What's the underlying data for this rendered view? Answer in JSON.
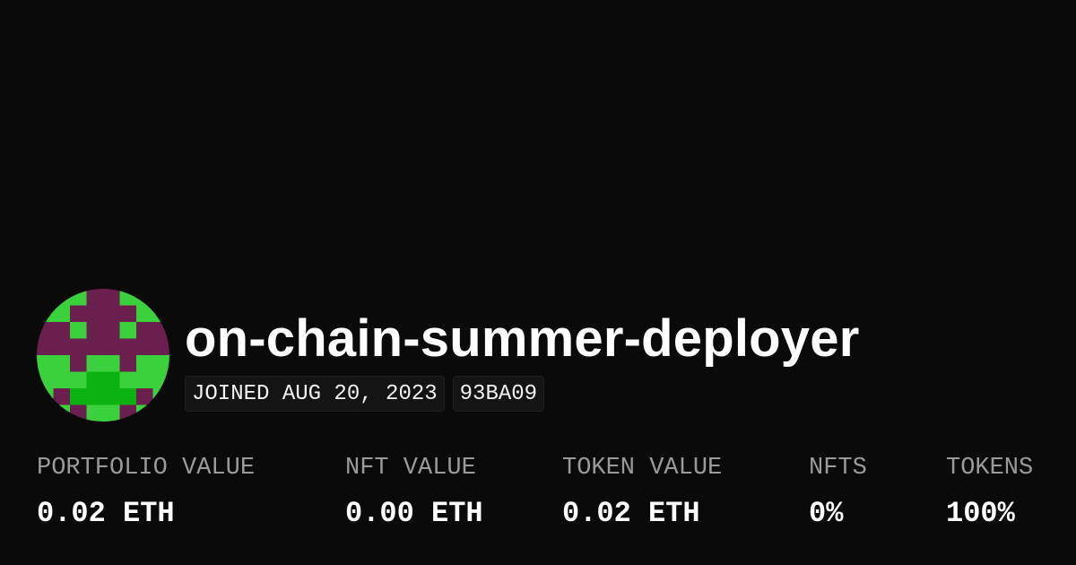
{
  "profile": {
    "name": "on-chain-summer-deployer",
    "joined": "JOINED AUG 20, 2023",
    "color_code": "93BA09",
    "avatar_colors": {
      "primary": "#6b1f4e",
      "secondary": "#3ad13d",
      "tertiary": "#0ab30f"
    }
  },
  "stats": [
    {
      "label": "PORTFOLIO VALUE",
      "value": "0.02 ETH"
    },
    {
      "label": "NFT VALUE",
      "value": "0.00 ETH"
    },
    {
      "label": "TOKEN VALUE",
      "value": "0.02 ETH"
    },
    {
      "label": "NFTS",
      "value": "0%"
    },
    {
      "label": "TOKENS",
      "value": "100%"
    }
  ]
}
